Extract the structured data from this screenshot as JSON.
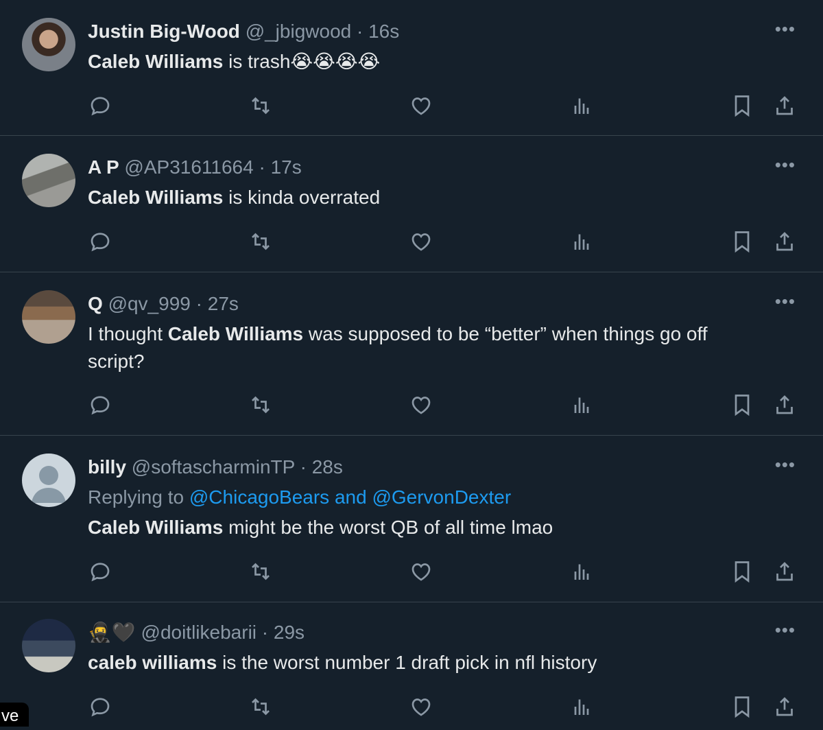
{
  "tweets": [
    {
      "name": "Justin Big-Wood",
      "handle": "@_jbigwood",
      "sep": "·",
      "time": "16s",
      "text_bold": "Caleb Williams",
      "text_rest": " is trash",
      "emoji": "😭😭😭😭"
    },
    {
      "name": "A P",
      "handle": "@AP31611664",
      "sep": "·",
      "time": "17s",
      "text_bold": "Caleb Williams",
      "text_rest": " is kinda overrated"
    },
    {
      "name": "Q",
      "handle": "@qv_999",
      "sep": "·",
      "time": "27s",
      "text_pre": "I thought ",
      "text_bold": "Caleb Williams",
      "text_rest": " was supposed to be “better” when things go off script?"
    },
    {
      "name": "billy",
      "handle": "@softascharminTP",
      "sep": "·",
      "time": "28s",
      "reply_prefix": "Replying to ",
      "reply_targets": "@ChicagoBears and @GervonDexter",
      "text_bold": "Caleb Williams",
      "text_rest": " might be the worst QB of all time lmao"
    },
    {
      "name_emoji": "🥷🖤",
      "handle": "@doitlikebarii",
      "sep": "·",
      "time": "29s",
      "text_bold": "caleb williams",
      "text_rest": " is the worst number 1 draft pick in nfl history"
    }
  ],
  "more_label": "•••",
  "corner_badge": "ve",
  "icons": [
    "reply-icon",
    "retweet-icon",
    "like-icon",
    "views-icon",
    "bookmark-icon",
    "share-icon"
  ],
  "colors": {
    "background": "#15202b",
    "text": "#e7e9ea",
    "muted": "#8b98a5",
    "link": "#1d9bf0",
    "border": "#38444d"
  }
}
